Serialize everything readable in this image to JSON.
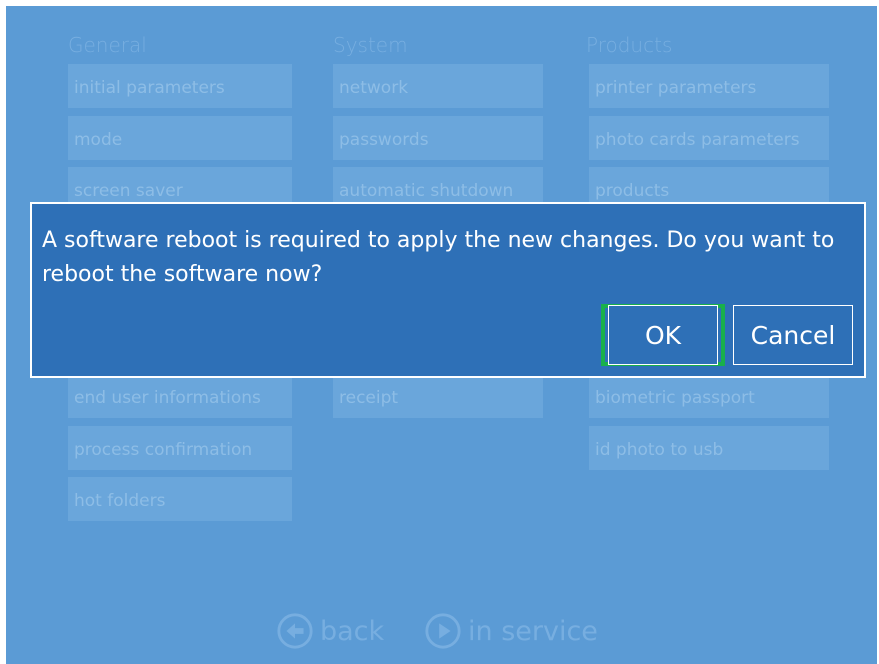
{
  "columns": {
    "general": {
      "header": "General",
      "items": [
        "initial parameters",
        "mode",
        "screen saver",
        "",
        "",
        "",
        "end user informations",
        "process confirmation",
        "hot folders"
      ]
    },
    "system": {
      "header": "System",
      "items": [
        "network",
        "passwords",
        "automatic shutdown",
        "",
        "",
        "",
        "receipt"
      ]
    },
    "products": {
      "header": "Products",
      "items": [
        "printer parameters",
        "photo cards parameters",
        "products",
        "",
        "",
        "",
        "biometric passport",
        "id photo to usb"
      ]
    }
  },
  "dialog": {
    "message": "A software reboot is required to apply the new changes. Do you want to reboot the software now?",
    "ok_label": "OK",
    "cancel_label": "Cancel"
  },
  "bottom_nav": {
    "back_label": "back",
    "back_icon": "arrow-left-circle-icon",
    "in_service_label": "in service",
    "in_service_icon": "play-circle-icon"
  },
  "colors": {
    "background": "#5b9bd5",
    "dialog": "#2e70b7",
    "ok_highlight": "#19b04b"
  }
}
